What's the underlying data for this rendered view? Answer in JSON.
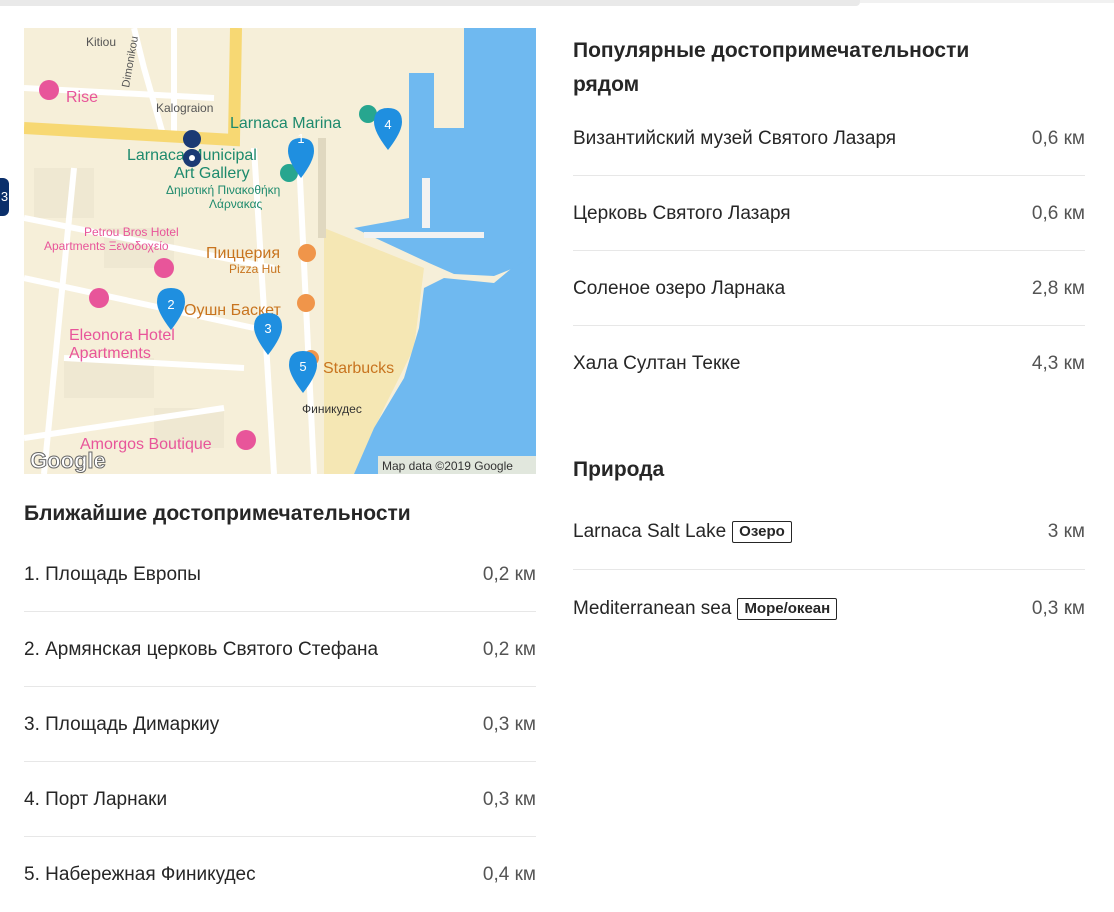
{
  "map": {
    "labels": {
      "kitiou": "Kitiou",
      "dimonikou": "Dimonikou",
      "rise": "Rise",
      "kalograion": "Kalograion",
      "marina": "Larnaca Marina",
      "gallery1": "Larnaca Municipal",
      "gallery2": "Art Gallery",
      "gallery_gr1": "Δημοτική Πινακοθήκη",
      "gallery_gr2": "Λάρνακας",
      "petrou1": "Petrou Bros Hotel",
      "petrou2": "Apartments Ξενοδοχείο",
      "pizza1": "Пиццерия",
      "pizza2": "Pizza Hut",
      "ocean": "Оушн Баскет",
      "eleonora1": "Eleonora Hotel",
      "eleonora2": "Apartments",
      "starbucks": "Starbucks",
      "finikoudes": "Финикудес",
      "amorgos": "Amorgos Boutique",
      "google": "Google",
      "attribution": "Map data ©2019 Google"
    },
    "markers": [
      "1",
      "2",
      "3",
      "4",
      "5"
    ]
  },
  "nearest": {
    "title": "Ближайшие достопримечательности",
    "items": [
      {
        "name": "1. Площадь Европы",
        "distance": "0,2 км"
      },
      {
        "name": "2. Армянская церковь Святого Стефана",
        "distance": "0,2 км"
      },
      {
        "name": "3. Площадь Димаркиу",
        "distance": "0,3 км"
      },
      {
        "name": "4. Порт Ларнаки",
        "distance": "0,3 км"
      },
      {
        "name": "5. Набережная Финикудес",
        "distance": "0,4 км"
      }
    ]
  },
  "popular": {
    "title_line1": "Популярные достопримечательности",
    "title_line2": "рядом",
    "items": [
      {
        "name": "Византийский музей Святого Лазаря",
        "distance": "0,6 км"
      },
      {
        "name": "Церковь Святого Лазаря",
        "distance": "0,6 км"
      },
      {
        "name": "Соленое озеро Ларнака",
        "distance": "2,8 км"
      },
      {
        "name": "Хала Султан Текке",
        "distance": "4,3 км"
      }
    ]
  },
  "nature": {
    "title": "Природа",
    "items": [
      {
        "name": "Larnaca Salt Lake",
        "badge": "Озеро",
        "distance": "3 км"
      },
      {
        "name": "Mediterranean sea",
        "badge": "Море/океан",
        "distance": "0,3 км"
      }
    ]
  },
  "colors": {
    "accent_marker": "#1f8fe0",
    "water": "#6fb9f0",
    "land": "#f6efd9",
    "sand": "#f5e7b4",
    "road_major": "#f7d873",
    "poi_pink": "#e8559a"
  }
}
